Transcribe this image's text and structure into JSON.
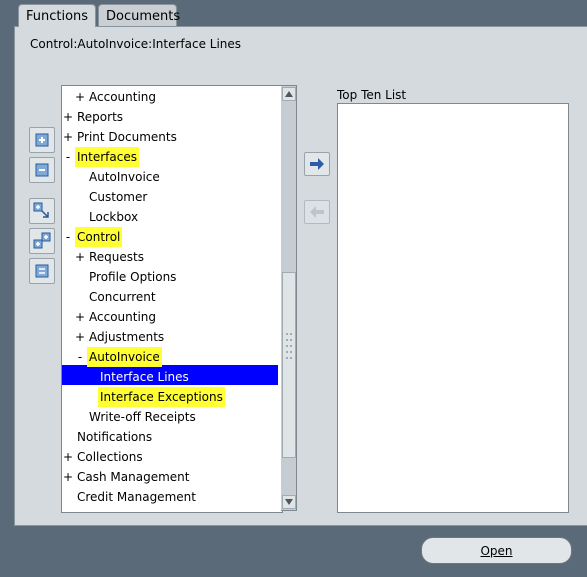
{
  "tabs": [
    {
      "label": "Functions",
      "active": true
    },
    {
      "label": "Documents",
      "active": false
    }
  ],
  "breadcrumb": "Control:AutoInvoice:Interface Lines",
  "left_buttons": [
    "expand-icon",
    "collapse-icon",
    "expand-all-icon",
    "expand-branch-icon",
    "collapse-all-icon"
  ],
  "move_buttons": [
    {
      "icon": "arrow-right-icon",
      "enabled": true
    },
    {
      "icon": "arrow-left-icon",
      "enabled": false
    }
  ],
  "tree": {
    "items": [
      {
        "label": "Accounting",
        "expander": "+",
        "level": 1
      },
      {
        "label": "Reports",
        "expander": "+",
        "level": 0
      },
      {
        "label": "Print Documents",
        "expander": "+",
        "level": 0
      },
      {
        "label": "Interfaces",
        "expander": "-",
        "level": 0,
        "highlight": true
      },
      {
        "label": "AutoInvoice",
        "expander": "",
        "level": 1
      },
      {
        "label": "Customer",
        "expander": "",
        "level": 1
      },
      {
        "label": "Lockbox",
        "expander": "",
        "level": 1
      },
      {
        "label": "Control",
        "expander": "-",
        "level": 0,
        "highlight": true
      },
      {
        "label": "Requests",
        "expander": "+",
        "level": 1
      },
      {
        "label": "Profile Options",
        "expander": "",
        "level": 1
      },
      {
        "label": "Concurrent",
        "expander": "",
        "level": 1
      },
      {
        "label": "Accounting",
        "expander": "+",
        "level": 1
      },
      {
        "label": "Adjustments",
        "expander": "+",
        "level": 1
      },
      {
        "label": "AutoInvoice",
        "expander": "-",
        "level": 1,
        "highlight": true
      },
      {
        "label": "Interface Lines",
        "expander": "",
        "level": 2,
        "selected": true
      },
      {
        "label": "Interface Exceptions",
        "expander": "",
        "level": 2,
        "highlight": true
      },
      {
        "label": "Write-off Receipts",
        "expander": "",
        "level": 1
      },
      {
        "label": "Notifications",
        "expander": "",
        "level": 0
      },
      {
        "label": "Collections",
        "expander": "+",
        "level": 0
      },
      {
        "label": "Cash Management",
        "expander": "+",
        "level": 0
      },
      {
        "label": "Credit Management",
        "expander": "",
        "level": 0
      }
    ]
  },
  "top_ten": {
    "label": "Top Ten List"
  },
  "open_button": {
    "label": "Open"
  },
  "colors": {
    "highlight": "#ffff33",
    "selection": "#0000ff",
    "window": "#5a6a78",
    "panel": "#d4dadd"
  }
}
